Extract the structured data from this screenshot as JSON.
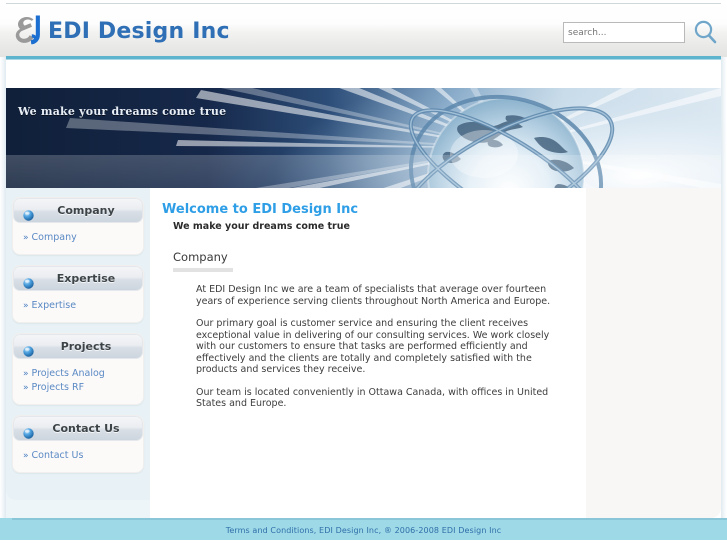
{
  "header": {
    "site_title": "EDI Design Inc",
    "logo_icon": "edi-monogram-logo",
    "search": {
      "placeholder": "search...",
      "value": "",
      "button_icon": "search-magnifier-icon"
    }
  },
  "banner": {
    "tagline": "We make your dreams come true",
    "image": "globe-network-banner"
  },
  "sidebar": {
    "blocks": [
      {
        "title": "Company",
        "icon": "blue-orb-icon",
        "links": [
          {
            "label": "Company"
          }
        ]
      },
      {
        "title": "Expertise",
        "icon": "blue-orb-icon",
        "links": [
          {
            "label": "Expertise"
          }
        ]
      },
      {
        "title": "Projects",
        "icon": "blue-orb-icon",
        "links": [
          {
            "label": "Projects Analog"
          },
          {
            "label": "Projects RF"
          }
        ]
      },
      {
        "title": "Contact Us",
        "icon": "blue-orb-icon",
        "links": [
          {
            "label": "Contact Us"
          }
        ]
      }
    ],
    "link_marker": "»"
  },
  "main": {
    "welcome_title": "Welcome to EDI Design Inc",
    "welcome_subtitle": "We make your dreams come true",
    "section_title": "Company",
    "paragraphs": [
      "At EDI Design Inc we are a team of specialists that average over fourteen years of experience serving clients throughout North America and Europe.",
      "Our primary goal is customer service and ensuring the client receives exceptional value in delivering of our consulting services. We work closely with our customers to ensure that tasks are performed efficiently and effectively and the clients are totally and completely satisfied with the products and services they receive.",
      "Our team is located conveniently in Ottawa Canada, with offices in United States and Europe."
    ]
  },
  "footer": {
    "text": "Terms and Conditions, EDI Design Inc, ® 2006-2008 EDI Design Inc"
  },
  "colors": {
    "brand_blue": "#2f6fb5",
    "heading_blue": "#2e9ee6",
    "link_blue": "#5b89c4",
    "accent_rule": "#5fb4cd",
    "footer_bg": "#9ed9e8",
    "sidebar_bg": "#e8f2f6",
    "banner_dark": "#14253f"
  }
}
